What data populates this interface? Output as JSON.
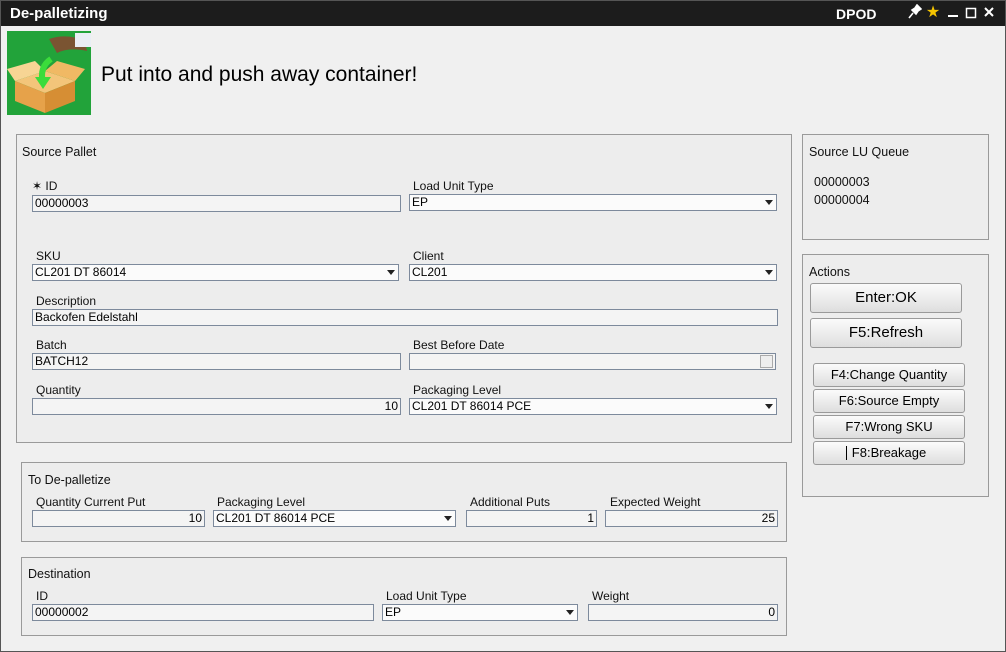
{
  "window": {
    "title": "De-palletizing",
    "app_name": "DPOD",
    "icons": [
      "pin-icon",
      "star-icon",
      "minimize-icon",
      "maximize-icon",
      "close-icon"
    ]
  },
  "header": {
    "headline": "Put into and push away container!",
    "logo_icon": "box-put-icon"
  },
  "source_pallet": {
    "title": "Source Pallet",
    "id": {
      "label": "✶ ID",
      "value": "00000003"
    },
    "load_unit_type": {
      "label": "Load Unit Type",
      "value": "EP"
    },
    "sku": {
      "label": "SKU",
      "value": "CL201 DT 86014"
    },
    "client": {
      "label": "Client",
      "value": "CL201"
    },
    "description": {
      "label": "Description",
      "value": "Backofen Edelstahl"
    },
    "batch": {
      "label": "Batch",
      "value": "BATCH12"
    },
    "best_before_date": {
      "label": "Best Before Date",
      "value": ""
    },
    "quantity": {
      "label": "Quantity",
      "value": "10"
    },
    "packaging_level": {
      "label": "Packaging Level",
      "value": "CL201 DT 86014 PCE"
    }
  },
  "to_depalletize": {
    "title": "To De-palletize",
    "quantity_current_put": {
      "label": "Quantity Current Put",
      "value": "10"
    },
    "packaging_level": {
      "label": "Packaging Level",
      "value": "CL201 DT 86014 PCE"
    },
    "additional_puts": {
      "label": "Additional Puts",
      "value": "1"
    },
    "expected_weight": {
      "label": "Expected Weight",
      "value": "25"
    }
  },
  "destination": {
    "title": "Destination",
    "id": {
      "label": "ID",
      "value": "00000002"
    },
    "load_unit_type": {
      "label": "Load Unit Type",
      "value": "EP"
    },
    "weight": {
      "label": "Weight",
      "value": "0"
    }
  },
  "source_lu_queue": {
    "title": "Source LU Queue",
    "items": [
      "00000003",
      "00000004"
    ]
  },
  "actions": {
    "title": "Actions",
    "ok": "Enter:OK",
    "refresh": "F5:Refresh",
    "change_quantity": "F4:Change Quantity",
    "source_empty": "F6:Source Empty",
    "wrong_sku": "F7:Wrong SKU",
    "breakage": "F8:Breakage"
  },
  "colors": {
    "titlebar": "#1c1c1c",
    "logo_background": "#22a33a",
    "star": "#f5c400"
  }
}
